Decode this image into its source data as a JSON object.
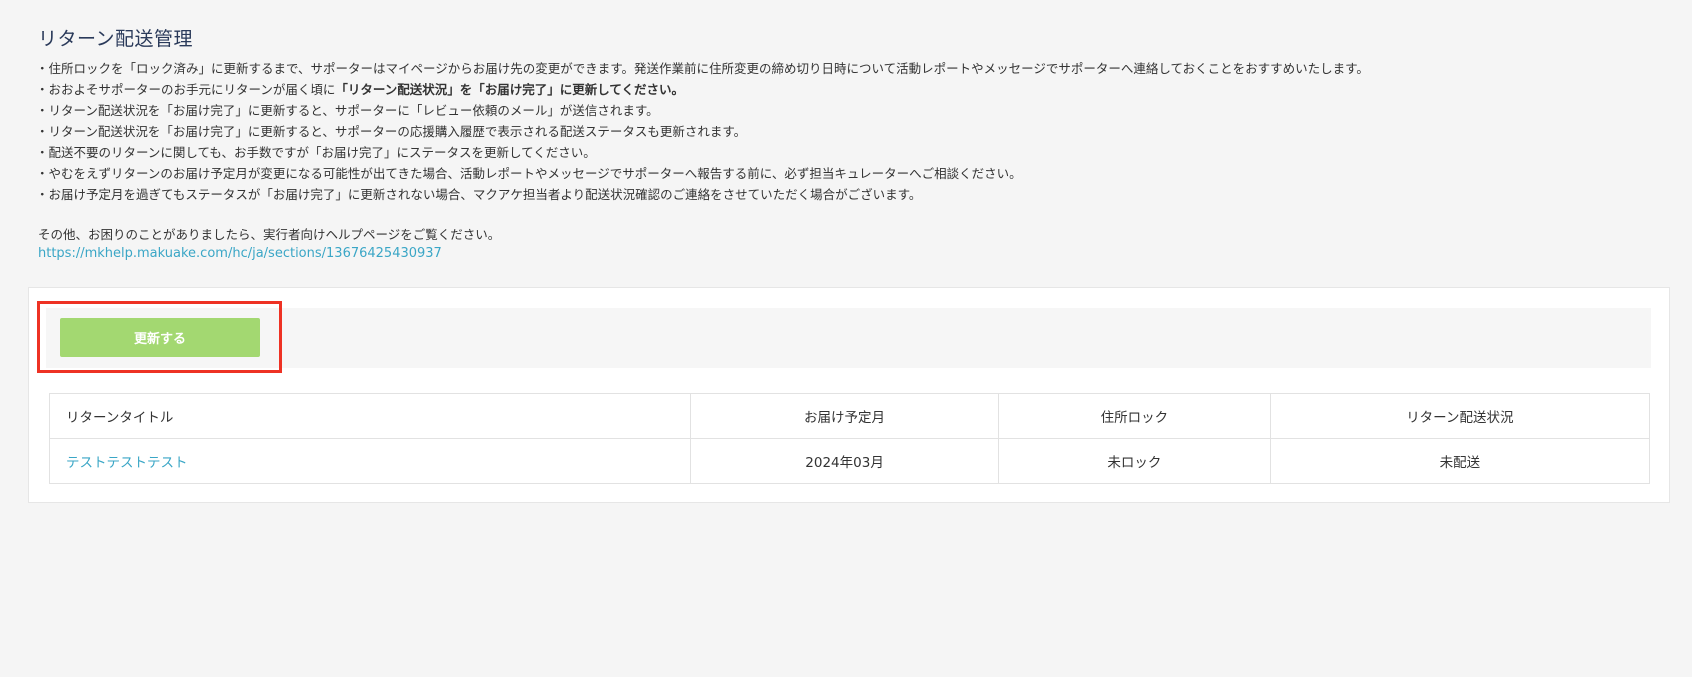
{
  "page": {
    "title": "リターン配送管理"
  },
  "notes": [
    {
      "text": "・住所ロックを「ロック済み」に更新するまで、サポーターはマイページからお届け先の変更ができます。発送作業前に住所変更の締め切り日時について活動レポートやメッセージでサポーターへ連絡しておくことをおすすめいたします。",
      "bold": ""
    },
    {
      "text": "・おおよそサポーターのお手元にリターンが届く頃に",
      "bold": "「リターン配送状況」を「お届け完了」に更新してください。"
    },
    {
      "text": "・リターン配送状況を「お届け完了」に更新すると、サポーターに「レビュー依頼のメール」が送信されます。",
      "bold": ""
    },
    {
      "text": "・リターン配送状況を「お届け完了」に更新すると、サポーターの応援購入履歴で表示される配送ステータスも更新されます。",
      "bold": ""
    },
    {
      "text": "・配送不要のリターンに関しても、お手数ですが「お届け完了」にステータスを更新してください。",
      "bold": ""
    },
    {
      "text": "・やむをえずリターンのお届け予定月が変更になる可能性が出てきた場合、活動レポートやメッセージでサポーターへ報告する前に、必ず担当キュレーターへご相談ください。",
      "bold": ""
    },
    {
      "text": "・お届け予定月を過ぎてもステータスが「お届け完了」に更新されない場合、マクアケ担当者より配送状況確認のご連絡をさせていただく場合がございます。",
      "bold": ""
    }
  ],
  "help": {
    "text": "その他、お困りのことがありましたら、実行者向けヘルプページをご覧ください。",
    "url": "https://mkhelp.makuake.com/hc/ja/sections/13676425430937"
  },
  "toolbar": {
    "update_label": "更新する"
  },
  "table": {
    "headers": {
      "title": "リターンタイトル",
      "delivery_month": "お届け予定月",
      "address_lock": "住所ロック",
      "shipping_status": "リターン配送状況"
    },
    "rows": [
      {
        "title": "テストテストテスト",
        "delivery_month": "2024年03月",
        "address_lock": "未ロック",
        "shipping_status": "未配送"
      }
    ]
  },
  "colors": {
    "accent_link": "#3aa6c6",
    "button_green": "#a3d871",
    "highlight_red": "#ee3224",
    "title_navy": "#2a3a5a"
  }
}
